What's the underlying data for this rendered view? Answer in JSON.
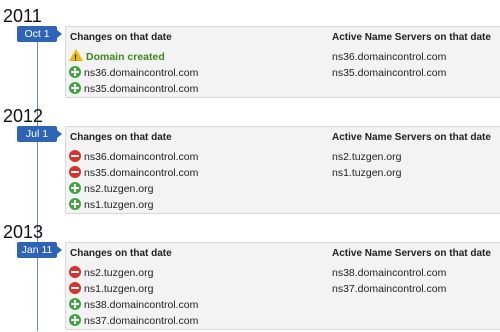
{
  "sections": [
    {
      "year": "2011",
      "date": "Oct 1",
      "changes_header": "Changes on that date",
      "ns_header": "Active Name Servers on that date",
      "changes": [
        {
          "type": "created",
          "icon": "warning-icon",
          "text": "Domain created"
        },
        {
          "type": "add",
          "icon": "add-icon",
          "text": "ns36.domaincontrol.com"
        },
        {
          "type": "add",
          "icon": "add-icon",
          "text": "ns35.domaincontrol.com"
        }
      ],
      "name_servers": [
        "ns36.domaincontrol.com",
        "ns35.domaincontrol.com"
      ]
    },
    {
      "year": "2012",
      "date": "Jul 1",
      "changes_header": "Changes on that date",
      "ns_header": "Active Name Servers on that date",
      "changes": [
        {
          "type": "remove",
          "icon": "remove-icon",
          "text": "ns36.domaincontrol.com"
        },
        {
          "type": "remove",
          "icon": "remove-icon",
          "text": "ns35.domaincontrol.com"
        },
        {
          "type": "add",
          "icon": "add-icon",
          "text": "ns2.tuzgen.org"
        },
        {
          "type": "add",
          "icon": "add-icon",
          "text": "ns1.tuzgen.org"
        }
      ],
      "name_servers": [
        "ns2.tuzgen.org",
        "ns1.tuzgen.org"
      ]
    },
    {
      "year": "2013",
      "date": "Jan 11",
      "changes_header": "Changes on that date",
      "ns_header": "Active Name Servers on that date",
      "changes": [
        {
          "type": "remove",
          "icon": "remove-icon",
          "text": "ns2.tuzgen.org"
        },
        {
          "type": "remove",
          "icon": "remove-icon",
          "text": "ns1.tuzgen.org"
        },
        {
          "type": "add",
          "icon": "add-icon",
          "text": "ns38.domaincontrol.com"
        },
        {
          "type": "add",
          "icon": "add-icon",
          "text": "ns37.domaincontrol.com"
        }
      ],
      "name_servers": [
        "ns38.domaincontrol.com",
        "ns37.domaincontrol.com"
      ]
    }
  ],
  "colors": {
    "badge": "#2e64b8",
    "created_text": "#3c8a1e",
    "add": "#3fa640",
    "remove": "#d9312b",
    "warning": "#f2b600"
  }
}
